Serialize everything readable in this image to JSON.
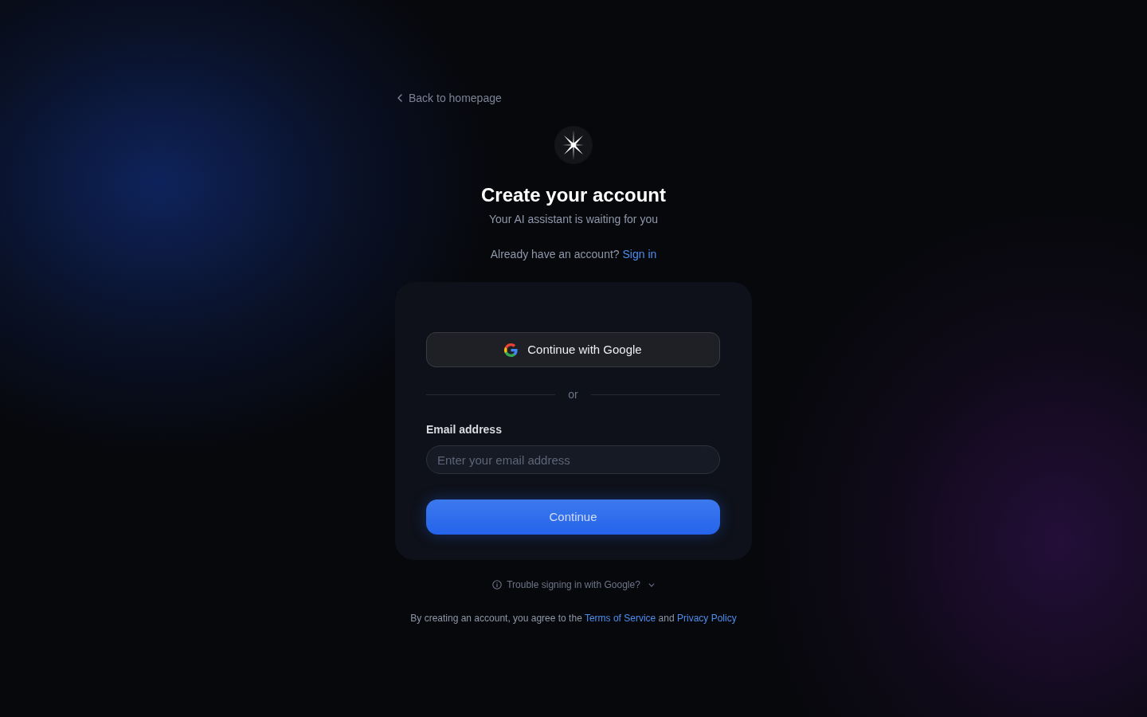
{
  "back_link": {
    "label": "Back to homepage"
  },
  "heading": {
    "title": "Create your account",
    "subtitle": "Your AI assistant is waiting for you"
  },
  "sign_in_prompt": {
    "text": "Already have an account?",
    "link": "Sign in"
  },
  "card": {
    "google_button": {
      "label": "Continue with Google"
    },
    "divider": "or",
    "email_field": {
      "label": "Email address",
      "placeholder": "Enter your email address"
    },
    "submit_button": {
      "label": "Continue"
    }
  },
  "help_toggle": {
    "label": "Trouble signing in with Google?",
    "expanded": false
  },
  "legal": {
    "text": "By creating an account, you agree to the",
    "terms_link": "Terms of Service",
    "conjunction": "and",
    "privacy_link": "Privacy Policy"
  }
}
